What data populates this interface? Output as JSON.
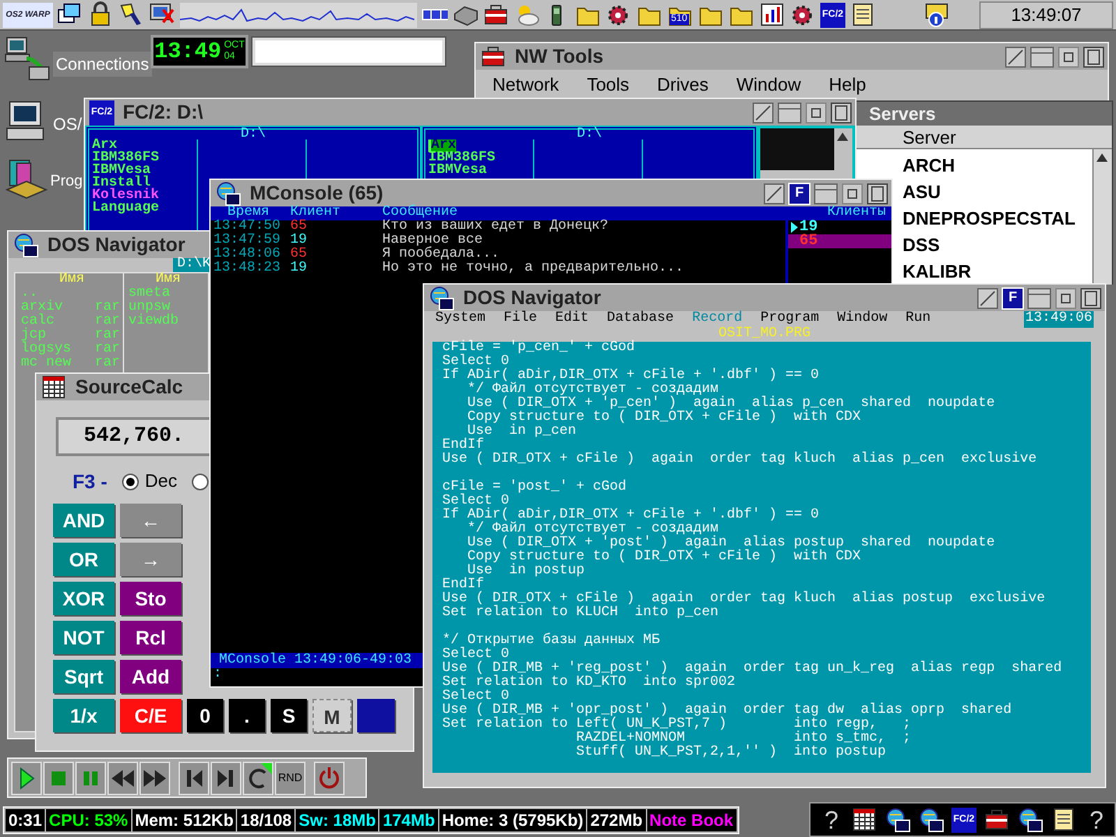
{
  "taskbar": {
    "logo": "OS2 WARP",
    "icons": [
      {
        "kind": "windows"
      },
      {
        "kind": "lock"
      },
      {
        "kind": "torch"
      },
      {
        "kind": "monitor"
      },
      {
        "kind": "cpu-graph"
      },
      {
        "kind": "squares"
      },
      {
        "kind": "drive"
      },
      {
        "kind": "toolbox"
      },
      {
        "kind": "weather"
      },
      {
        "kind": "phone"
      },
      {
        "kind": "folder"
      },
      {
        "kind": "gear"
      },
      {
        "kind": "folder"
      },
      {
        "kind": "folder",
        "label": "510"
      },
      {
        "kind": "folder"
      },
      {
        "kind": "folder"
      },
      {
        "kind": "chart"
      },
      {
        "kind": "gear"
      },
      {
        "kind": "logo",
        "label": "FC/2"
      },
      {
        "kind": "note"
      },
      {
        "kind": "spacer"
      },
      {
        "kind": "info"
      }
    ],
    "clock": "13:49:07"
  },
  "desktop_icons": [
    {
      "kind": "network",
      "label": "Connections"
    },
    {
      "kind": "computer",
      "label": "OS/"
    },
    {
      "kind": "programs",
      "label": "Prog"
    }
  ],
  "clock_widget": {
    "time": "13:49",
    "month": "OCT",
    "day": "04"
  },
  "nw_tools": {
    "title": "NW Tools",
    "menu": [
      "Network",
      "Tools",
      "Drives",
      "Window",
      "Help"
    ]
  },
  "servers": {
    "title": "Servers",
    "column": "Server",
    "items": [
      "ARCH",
      "ASU",
      "DNEPROSPECSTAL",
      "DSS",
      "KALIBR"
    ]
  },
  "fc2": {
    "icon_label": "FC/2",
    "title": "FC/2: D:\\",
    "panels": [
      {
        "path": "D:\\",
        "files": [
          {
            "name": "Arx",
            "color": "#54fc54",
            "selected": false
          },
          {
            "name": "IBM386FS",
            "color": "#54fc54",
            "selected": false
          },
          {
            "name": "IBMVesa",
            "color": "#54fc54",
            "selected": false
          },
          {
            "name": "Install",
            "color": "#54fc54",
            "selected": false
          },
          {
            "name": "Kolesnik",
            "color": "#fc54fc",
            "selected": false
          },
          {
            "name": "Language",
            "color": "#54fc54",
            "selected": false
          }
        ]
      },
      {
        "path": "D:\\",
        "files": [
          {
            "name": "Arx",
            "color": "#54fc54",
            "selected": true
          },
          {
            "name": "IBM386FS",
            "color": "#54fc54",
            "selected": false
          },
          {
            "name": "IBMVesa",
            "color": "#54fc54",
            "selected": false
          }
        ]
      }
    ]
  },
  "dos_small": {
    "title": "DOS Navigator",
    "path": "D:\\K",
    "panels": [
      {
        "header": "Имя",
        "files": [
          {
            "name": ".."
          },
          {
            "name": "arxiv",
            "ext": "rar"
          },
          {
            "name": "calc",
            "ext": "rar"
          },
          {
            "name": "jcp",
            "ext": "rar"
          },
          {
            "name": "logsys",
            "ext": "rar"
          },
          {
            "name": "mc new",
            "ext": "rar"
          }
        ]
      },
      {
        "header": "Имя",
        "files": [
          {
            "name": "smeta"
          },
          {
            "name": "unpsw"
          },
          {
            "name": "viewdb"
          }
        ]
      }
    ]
  },
  "calc": {
    "title": "SourceCalc",
    "display": "542,760.",
    "mode_key": "F3 -",
    "radios": [
      {
        "label": "Dec",
        "selected": true
      },
      {
        "selected": false
      }
    ],
    "rows": [
      [
        {
          "label": "AND",
          "kind": "logic"
        },
        {
          "label": "←",
          "kind": "arrow"
        }
      ],
      [
        {
          "label": "OR",
          "kind": "logic"
        },
        {
          "label": "→",
          "kind": "arrow"
        }
      ],
      [
        {
          "label": "XOR",
          "kind": "logic"
        },
        {
          "label": "Sto",
          "kind": "memory"
        }
      ],
      [
        {
          "label": "NOT",
          "kind": "logic"
        },
        {
          "label": "Rcl",
          "kind": "memory"
        }
      ],
      [
        {
          "label": "Sqrt",
          "kind": "logic"
        },
        {
          "label": "Add",
          "kind": "memory"
        }
      ],
      [
        {
          "label": "1/x",
          "kind": "logic"
        },
        {
          "label": "C/E",
          "kind": "clear"
        },
        {
          "label": "0",
          "kind": "digit"
        },
        {
          "label": ".",
          "kind": "digit"
        },
        {
          "label": "S",
          "kind": "digit"
        },
        {
          "label": "M",
          "kind": "mark"
        },
        {
          "kind": "blank"
        }
      ]
    ]
  },
  "mconsole": {
    "title": "MConsole (65)",
    "float_button": "F",
    "columns": [
      "Время",
      "Клиент",
      "Сообщение"
    ],
    "clients_header": "Клиенты",
    "messages": [
      {
        "time": "13:47:50",
        "client": "65",
        "color": "#ff3030",
        "text": "Кто из ваших едет в Донецк?"
      },
      {
        "time": "13:47:59",
        "client": "19",
        "color": "#40ffff",
        "text": "Наверное все"
      },
      {
        "time": "13:48:06",
        "client": "65",
        "color": "#ff3030",
        "text": "Я пообедала..."
      },
      {
        "time": "13:48:23",
        "client": "19",
        "color": "#40ffff",
        "text": "Но это не точно, а предварительно..."
      }
    ],
    "clients": [
      {
        "name": "19",
        "selected": false,
        "pointer": true
      },
      {
        "name": "65",
        "selected": true,
        "pointer": false
      }
    ],
    "status": "MConsole 13:49:06-49:03",
    "prompt": ":"
  },
  "dos_editor": {
    "title": "DOS Navigator",
    "float_button": "F",
    "menu": [
      {
        "label": "System",
        "selected": false
      },
      {
        "label": "File",
        "selected": false
      },
      {
        "label": "Edit",
        "selected": false
      },
      {
        "label": "Database",
        "selected": false
      },
      {
        "label": "Record",
        "selected": true
      },
      {
        "label": "Program",
        "selected": false
      },
      {
        "label": "Window",
        "selected": false
      },
      {
        "label": "Run",
        "selected": false
      }
    ],
    "clock": "13:49:06",
    "file": "OSIT_MO.PRG",
    "code_blocks": [
      [
        "cFile = 'p_cen_' + cGod",
        "Select 0",
        "If ADir( aDir,DIR_OTX + cFile + '.dbf' ) == 0",
        "   */ Файл отсутствует - создадим",
        "   Use ( DIR_OTX + 'p_cen' )  again  alias p_cen  shared  noupdate",
        "   Copy structure to ( DIR_OTX + cFile )  with CDX",
        "   Use  in p_cen",
        "EndIf",
        "Use ( DIR_OTX + cFile )  again  order tag kluch  alias p_cen  exclusive"
      ],
      [
        "cFile = 'post_' + cGod",
        "Select 0",
        "If ADir( aDir,DIR_OTX + cFile + '.dbf' ) == 0",
        "   */ Файл отсутствует - создадим",
        "   Use ( DIR_OTX + 'post' )  again  alias postup  shared  noupdate",
        "   Copy structure to ( DIR_OTX + cFile )  with CDX",
        "   Use  in postup",
        "EndIf",
        "Use ( DIR_OTX + cFile )  again  order tag kluch  alias postup  exclusive",
        "Set relation to KLUCH  into p_cen"
      ],
      [
        "*/ Открытие базы данных МБ",
        "Select 0",
        "Use ( DIR_MB + 'reg_post' )  again  order tag un_k_reg  alias regp  shared",
        "Set relation to KD_KTO  into spr002",
        "Select 0",
        "Use ( DIR_MB + 'opr_post' )  again  order tag dw  alias oprp  shared",
        "Set relation to Left( UN_K_PST,7 )        into regp,   ;",
        "                RAZDEL+NOMNOM             into s_tmc,  ;",
        "                Stuff( UN_K_PST,2,1,'' )  into postup"
      ]
    ]
  },
  "player": {
    "buttons": [
      {
        "kind": "play"
      },
      {
        "kind": "stop"
      },
      {
        "kind": "pause"
      },
      {
        "kind": "rewind"
      },
      {
        "kind": "forward"
      },
      {
        "kind": "gap"
      },
      {
        "kind": "previous"
      },
      {
        "kind": "next"
      },
      {
        "kind": "repeat"
      },
      {
        "kind": "random",
        "label": "RND"
      },
      {
        "kind": "gap"
      },
      {
        "kind": "power"
      }
    ]
  },
  "status_bar": [
    {
      "text": "0:31",
      "color": "#ffffff"
    },
    {
      "text": "CPU: 53%",
      "color": "#00ff00"
    },
    {
      "text": "Mem: 512Kb",
      "color": "#ffffff"
    },
    {
      "text": "18/108",
      "color": "#ffffff"
    },
    {
      "text": "Sw: 18Mb",
      "color": "#00ffff"
    },
    {
      "text": "174Mb",
      "color": "#00ffff"
    },
    {
      "text": "Home: 3 (5795Kb)",
      "color": "#ffffff"
    },
    {
      "text": "272Mb",
      "color": "#ffffff"
    },
    {
      "text": "Note Book",
      "color": "#ff00ff"
    }
  ],
  "tray": [
    {
      "kind": "help",
      "label": "?"
    },
    {
      "kind": "calculator"
    },
    {
      "kind": "dos"
    },
    {
      "kind": "dos"
    },
    {
      "kind": "logo",
      "label": "FC/2"
    },
    {
      "kind": "toolbox"
    },
    {
      "kind": "dos"
    },
    {
      "kind": "note"
    },
    {
      "kind": "help",
      "label": "?"
    }
  ]
}
